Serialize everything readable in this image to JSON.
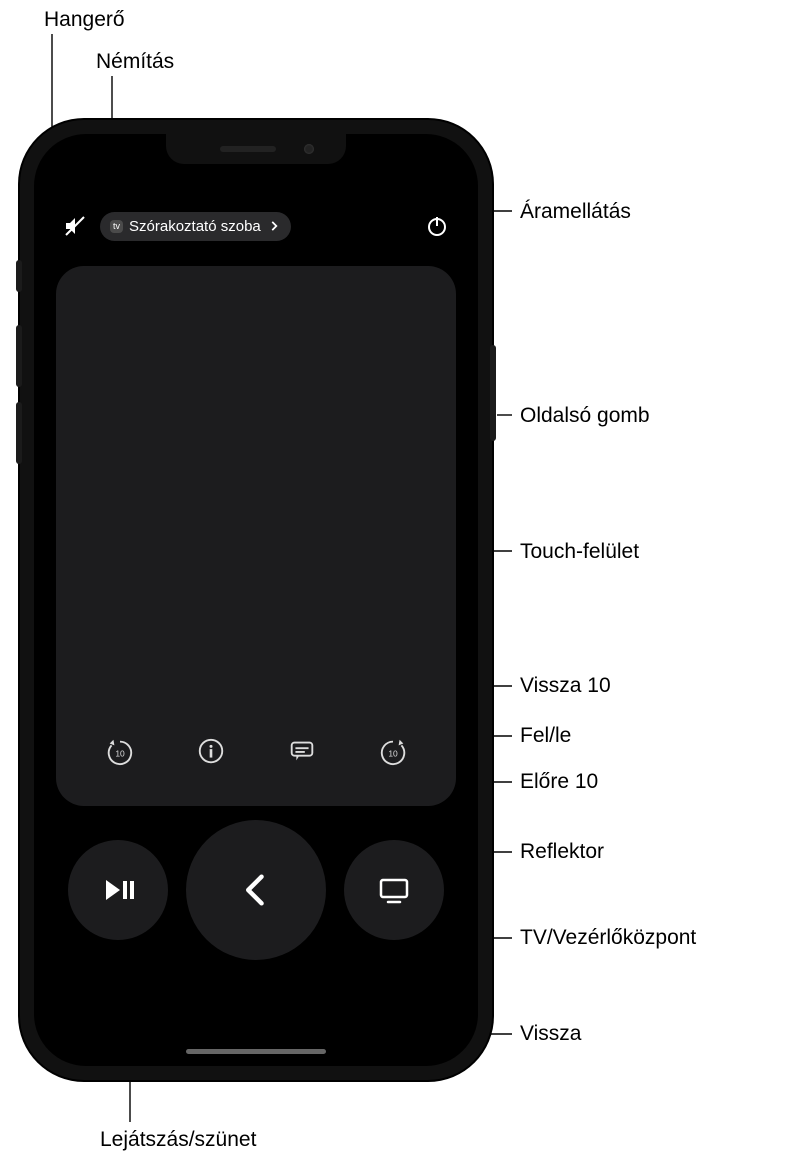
{
  "topbar": {
    "device_label": "Szórakoztató szoba",
    "tv_badge": "tv"
  },
  "callouts": {
    "volume": "Hangerő",
    "mute": "Némítás",
    "power": "Áramellátás",
    "side_button": "Oldalsó gomb",
    "touch_surface": "Touch-felület",
    "skip_back": "Vissza 10",
    "captions": "Fel/le",
    "skip_fwd": "Előre 10",
    "info": "Reflektor",
    "tv_control": "TV/Vezérlőközpont",
    "back": "Vissza",
    "play_pause": "Lejátszás/szünet"
  },
  "icons": {
    "skip_back_num": "10",
    "skip_fwd_num": "10"
  }
}
